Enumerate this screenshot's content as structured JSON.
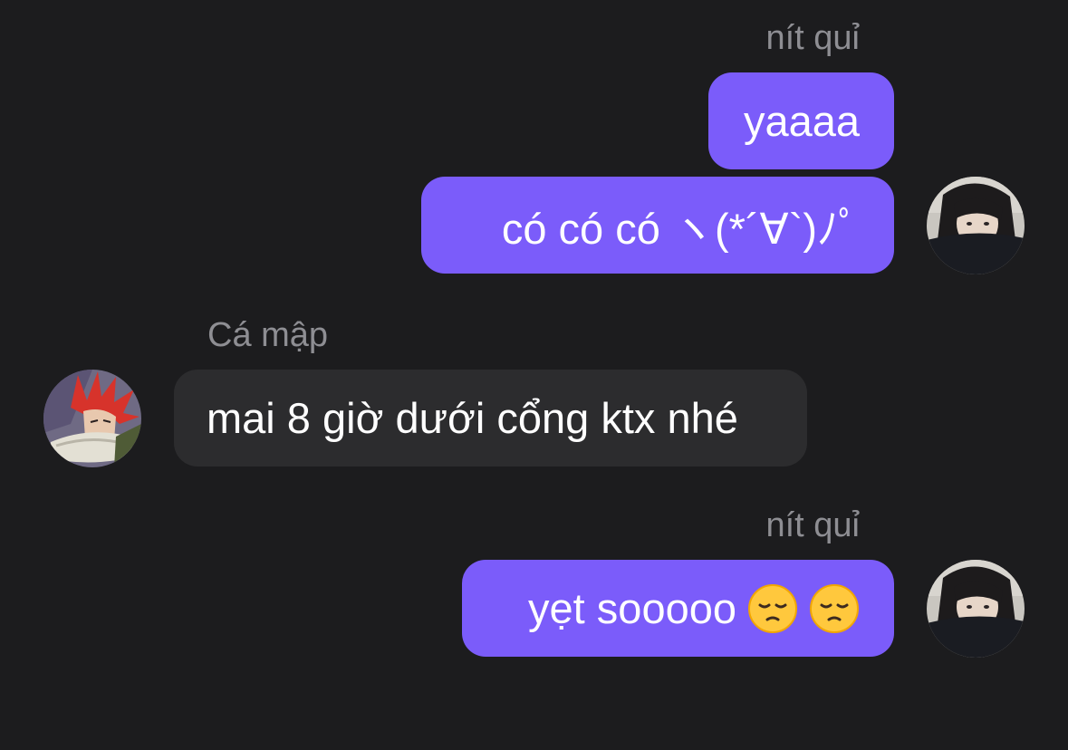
{
  "messages": [
    {
      "sender": "nít quỉ",
      "direction": "outgoing",
      "text": "yaaaa"
    },
    {
      "sender": "nít quỉ",
      "direction": "outgoing",
      "text": "có có có ヽ(*´∀`)ﾉﾟ"
    },
    {
      "sender": "Cá mập",
      "direction": "incoming",
      "text": "mai 8 giờ dưới cổng ktx nhé"
    },
    {
      "sender": "nít quỉ",
      "direction": "outgoing",
      "text": "yẹt sooooo",
      "emojis": [
        "pensive-face",
        "pensive-face"
      ]
    }
  ],
  "colors": {
    "background": "#1c1c1e",
    "outgoing_bubble": "#7b5cfa",
    "incoming_bubble": "#2c2c2e",
    "sender_name": "#8e8e93",
    "text": "#ffffff"
  }
}
